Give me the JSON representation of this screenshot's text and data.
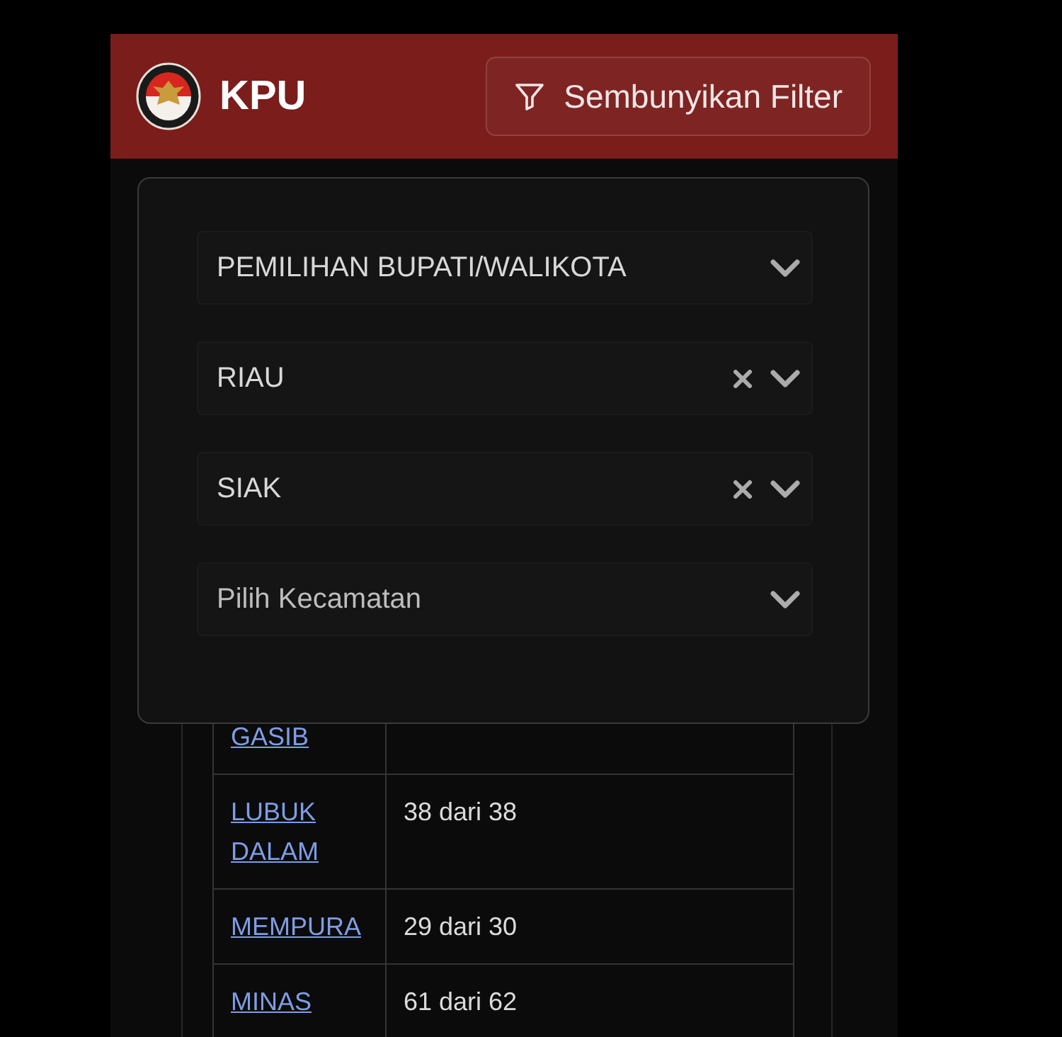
{
  "header": {
    "brand": "KPU",
    "filter_button": "Sembunyikan Filter"
  },
  "filters": [
    {
      "value": "PEMILIHAN BUPATI/WALIKOTA",
      "clearable": false
    },
    {
      "value": "RIAU",
      "clearable": true
    },
    {
      "value": "SIAK",
      "clearable": true
    },
    {
      "placeholder": "Pilih Kecamatan",
      "clearable": false
    }
  ],
  "table": {
    "rows": [
      {
        "name": "GASIB"
      },
      {
        "name": "LUBUK DALAM",
        "count": "38 dari 38"
      },
      {
        "name": "MEMPURA",
        "count": "29 dari 30"
      },
      {
        "name": "MINAS",
        "count": "61 dari 62"
      }
    ]
  }
}
